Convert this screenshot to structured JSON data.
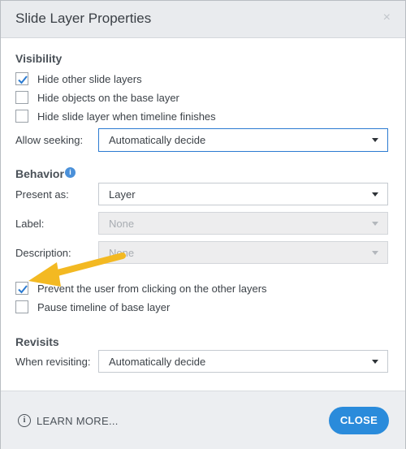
{
  "dialog": {
    "title": "Slide Layer Properties",
    "close_glyph": "×"
  },
  "visibility": {
    "heading": "Visibility",
    "options": [
      {
        "label": "Hide other slide layers",
        "checked": true
      },
      {
        "label": "Hide objects on the base layer",
        "checked": false
      },
      {
        "label": "Hide slide layer when timeline finishes",
        "checked": false
      }
    ],
    "allow_seeking_label": "Allow seeking:",
    "allow_seeking_value": "Automatically decide"
  },
  "behavior": {
    "heading": "Behavior",
    "info_glyph": "i",
    "present_as_label": "Present as:",
    "present_as_value": "Layer",
    "label_label": "Label:",
    "label_value": "None",
    "description_label": "Description:",
    "description_value": "None",
    "options": [
      {
        "label": "Prevent the user from clicking on the other layers",
        "checked": true
      },
      {
        "label": "Pause timeline of base layer",
        "checked": false
      }
    ]
  },
  "revisits": {
    "heading": "Revisits",
    "when_revisiting_label": "When revisiting:",
    "when_revisiting_value": "Automatically decide"
  },
  "footer": {
    "learn_more_icon": "i",
    "learn_more_label": "LEARN MORE...",
    "close_label": "CLOSE"
  },
  "colors": {
    "accent": "#2a8bdb",
    "checkmark": "#2b7bd1",
    "annotation_arrow": "#f3b922"
  }
}
